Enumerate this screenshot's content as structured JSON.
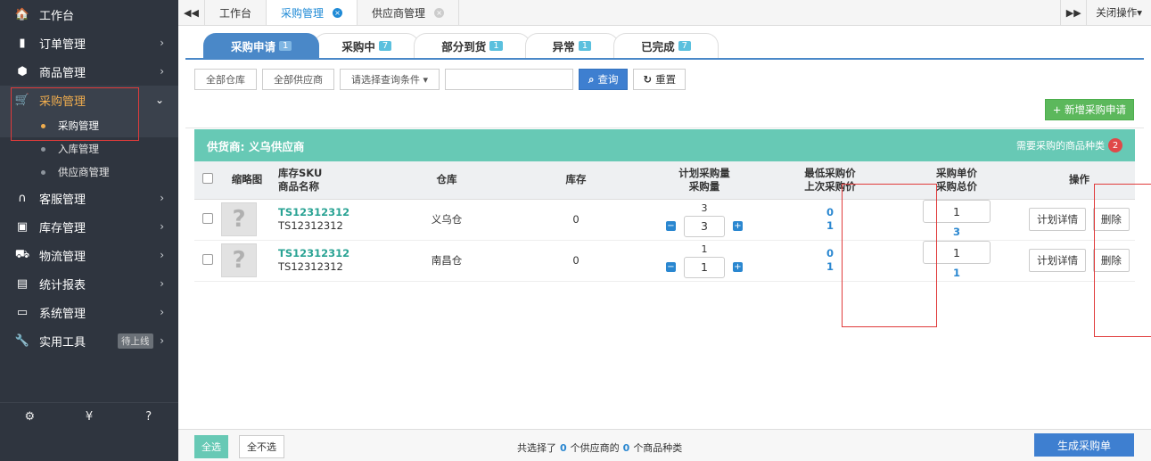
{
  "sidebar": {
    "items": [
      {
        "icon": "home-icon",
        "glyph": "🏠",
        "label": "工作台",
        "arrow": ""
      },
      {
        "icon": "clipboard-icon",
        "glyph": "▮",
        "label": "订单管理",
        "arrow": "›"
      },
      {
        "icon": "box-icon",
        "glyph": "⬢",
        "label": "商品管理",
        "arrow": "›"
      },
      {
        "icon": "cart-icon",
        "glyph": "🛒",
        "label": "采购管理",
        "arrow": "⌄"
      }
    ],
    "purchase_sub": [
      {
        "label": "采购管理"
      },
      {
        "label": "入库管理"
      },
      {
        "label": "供应商管理"
      }
    ],
    "items2": [
      {
        "icon": "headset-icon",
        "glyph": "∩",
        "label": "客服管理",
        "arrow": "›"
      },
      {
        "icon": "storage-icon",
        "glyph": "▣",
        "label": "库存管理",
        "arrow": "›"
      },
      {
        "icon": "truck-icon",
        "glyph": "⛟",
        "label": "物流管理",
        "arrow": "›"
      },
      {
        "icon": "report-icon",
        "glyph": "▤",
        "label": "统计报表",
        "arrow": "›"
      },
      {
        "icon": "monitor-icon",
        "glyph": "▭",
        "label": "系统管理",
        "arrow": "›"
      },
      {
        "icon": "wrench-icon",
        "glyph": "🔧",
        "label": "实用工具",
        "arrow": "›",
        "badge": "待上线"
      }
    ],
    "bottom_icons": [
      {
        "name": "gear-icon",
        "glyph": "⚙"
      },
      {
        "name": "yen-icon",
        "glyph": "¥"
      },
      {
        "name": "help-icon",
        "glyph": "?"
      }
    ]
  },
  "topbar": {
    "back_glyph": "◀◀",
    "tabs": [
      {
        "label": "工作台",
        "closable": false,
        "active": false
      },
      {
        "label": "采购管理",
        "closable": true,
        "active": true
      },
      {
        "label": "供应商管理",
        "closable": true,
        "active": false
      }
    ],
    "forward_glyph": "▶▶",
    "close_ops": "关闭操作▾"
  },
  "status_tabs": [
    {
      "label": "采购申请",
      "count": "1",
      "active": true
    },
    {
      "label": "采购中",
      "count": "7",
      "active": false
    },
    {
      "label": "部分到货",
      "count": "1",
      "active": false
    },
    {
      "label": "异常",
      "count": "1",
      "active": false
    },
    {
      "label": "已完成",
      "count": "7",
      "active": false
    }
  ],
  "filter": {
    "warehouse": "全部仓库",
    "supplier": "全部供应商",
    "condition": "请选择查询条件 ▾",
    "search_value": "",
    "query_label": "查询",
    "reset_label": "重置"
  },
  "add_button": "+ 新增采购申请",
  "supplier": {
    "name": "供货商: 义乌供应商",
    "need_label": "需要采购的商品种类",
    "need_count": "2"
  },
  "table": {
    "headers": {
      "thumb": "缩略图",
      "sku": "库存SKU",
      "product": "商品名称",
      "warehouse": "仓库",
      "stock": "库存",
      "plan_qty": "计划采购量",
      "qty": "采购量",
      "min_price": "最低采购价",
      "last_price": "上次采购价",
      "unit_price": "采购单价",
      "total_price": "采购总价",
      "ops": "操作"
    },
    "rows": [
      {
        "sku": "TS12312312",
        "name": "TS12312312",
        "warehouse": "义乌仓",
        "stock": "0",
        "plan": "3",
        "qty": "3",
        "min_price": "0",
        "last_price": "1",
        "unit_price": "1",
        "total": "3"
      },
      {
        "sku": "TS12312312",
        "name": "TS12312312",
        "warehouse": "南昌仓",
        "stock": "0",
        "plan": "1",
        "qty": "1",
        "min_price": "0",
        "last_price": "1",
        "unit_price": "1",
        "total": "1"
      }
    ],
    "ops": {
      "detail": "计划详情",
      "delete": "删除"
    }
  },
  "footer": {
    "select_all": "全选",
    "select_none": "全不选",
    "summary_pre": "共选择了",
    "supplier_count": "0",
    "summary_mid": "个供应商的",
    "kind_count": "0",
    "summary_post": "个商品种类",
    "generate": "生成采购单"
  }
}
